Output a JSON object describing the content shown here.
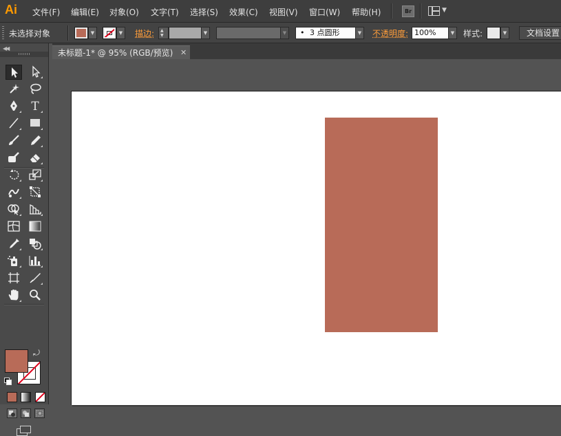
{
  "app": {
    "logo": "Ai"
  },
  "menu": {
    "items": [
      "文件(F)",
      "编辑(E)",
      "对象(O)",
      "文字(T)",
      "选择(S)",
      "效果(C)",
      "视图(V)",
      "窗口(W)",
      "帮助(H)"
    ],
    "bridge_label": "Br"
  },
  "control_bar": {
    "selection_status": "未选择对象",
    "stroke_label": "描边:",
    "brush_value": "3 点圆形",
    "opacity_label": "不透明度:",
    "opacity_value": "100%",
    "style_label": "样式:",
    "doc_setup_label": "文档设置"
  },
  "document": {
    "tab_title": "未标题-1* @ 95% (RGB/预览)",
    "close_glyph": "✕"
  },
  "colors": {
    "fill": "#b86b58",
    "stroke": "none",
    "accent_orange": "#ff9d3a"
  },
  "toolbar": {
    "tools": [
      [
        "selection-tool",
        "direct-selection-tool"
      ],
      [
        "magic-wand-tool",
        "lasso-tool"
      ],
      [
        "pen-tool",
        "type-tool"
      ],
      [
        "line-segment-tool",
        "rectangle-tool"
      ],
      [
        "paintbrush-tool",
        "pencil-tool"
      ],
      [
        "blob-brush-tool",
        "eraser-tool"
      ],
      [
        "rotate-tool",
        "scale-tool"
      ],
      [
        "warp-tool",
        "free-transform-tool"
      ],
      [
        "shape-builder-tool",
        "perspective-grid-tool"
      ],
      [
        "mesh-tool",
        "gradient-tool"
      ],
      [
        "eyedropper-tool",
        "blend-tool"
      ],
      [
        "symbol-sprayer-tool",
        "column-graph-tool"
      ],
      [
        "artboard-tool",
        "slice-tool"
      ],
      [
        "hand-tool",
        "zoom-tool"
      ]
    ],
    "type_tool_glyph": "T"
  }
}
